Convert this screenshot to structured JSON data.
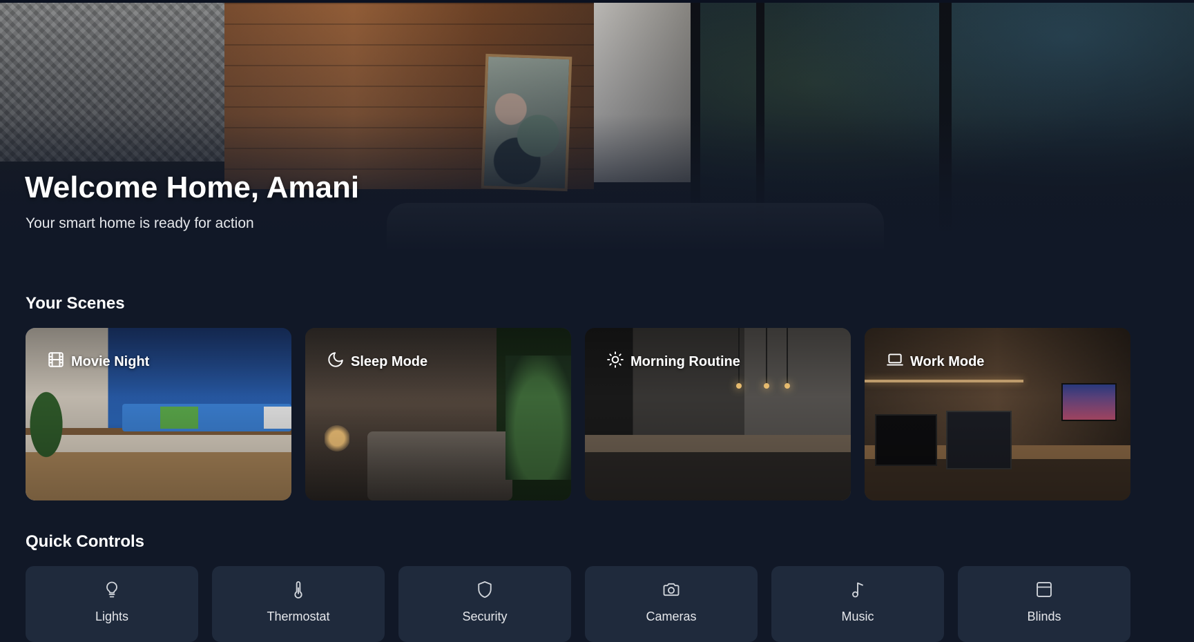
{
  "hero": {
    "title": "Welcome Home, Amani",
    "subtitle": "Your smart home is ready for action"
  },
  "scenes": {
    "title": "Your Scenes",
    "items": [
      {
        "label": "Movie Night",
        "icon": "film-icon"
      },
      {
        "label": "Sleep Mode",
        "icon": "moon-icon"
      },
      {
        "label": "Morning Routine",
        "icon": "sun-icon"
      },
      {
        "label": "Work Mode",
        "icon": "laptop-icon"
      }
    ]
  },
  "quick_controls": {
    "title": "Quick Controls",
    "items": [
      {
        "label": "Lights",
        "icon": "lightbulb-icon"
      },
      {
        "label": "Thermostat",
        "icon": "thermometer-icon"
      },
      {
        "label": "Security",
        "icon": "shield-icon"
      },
      {
        "label": "Cameras",
        "icon": "camera-icon"
      },
      {
        "label": "Music",
        "icon": "music-note-icon"
      },
      {
        "label": "Blinds",
        "icon": "blinds-icon"
      }
    ]
  },
  "colors": {
    "background": "#111827",
    "card": "#1f2a3c",
    "text": "#ffffff",
    "muted_text": "#e5e7eb"
  }
}
